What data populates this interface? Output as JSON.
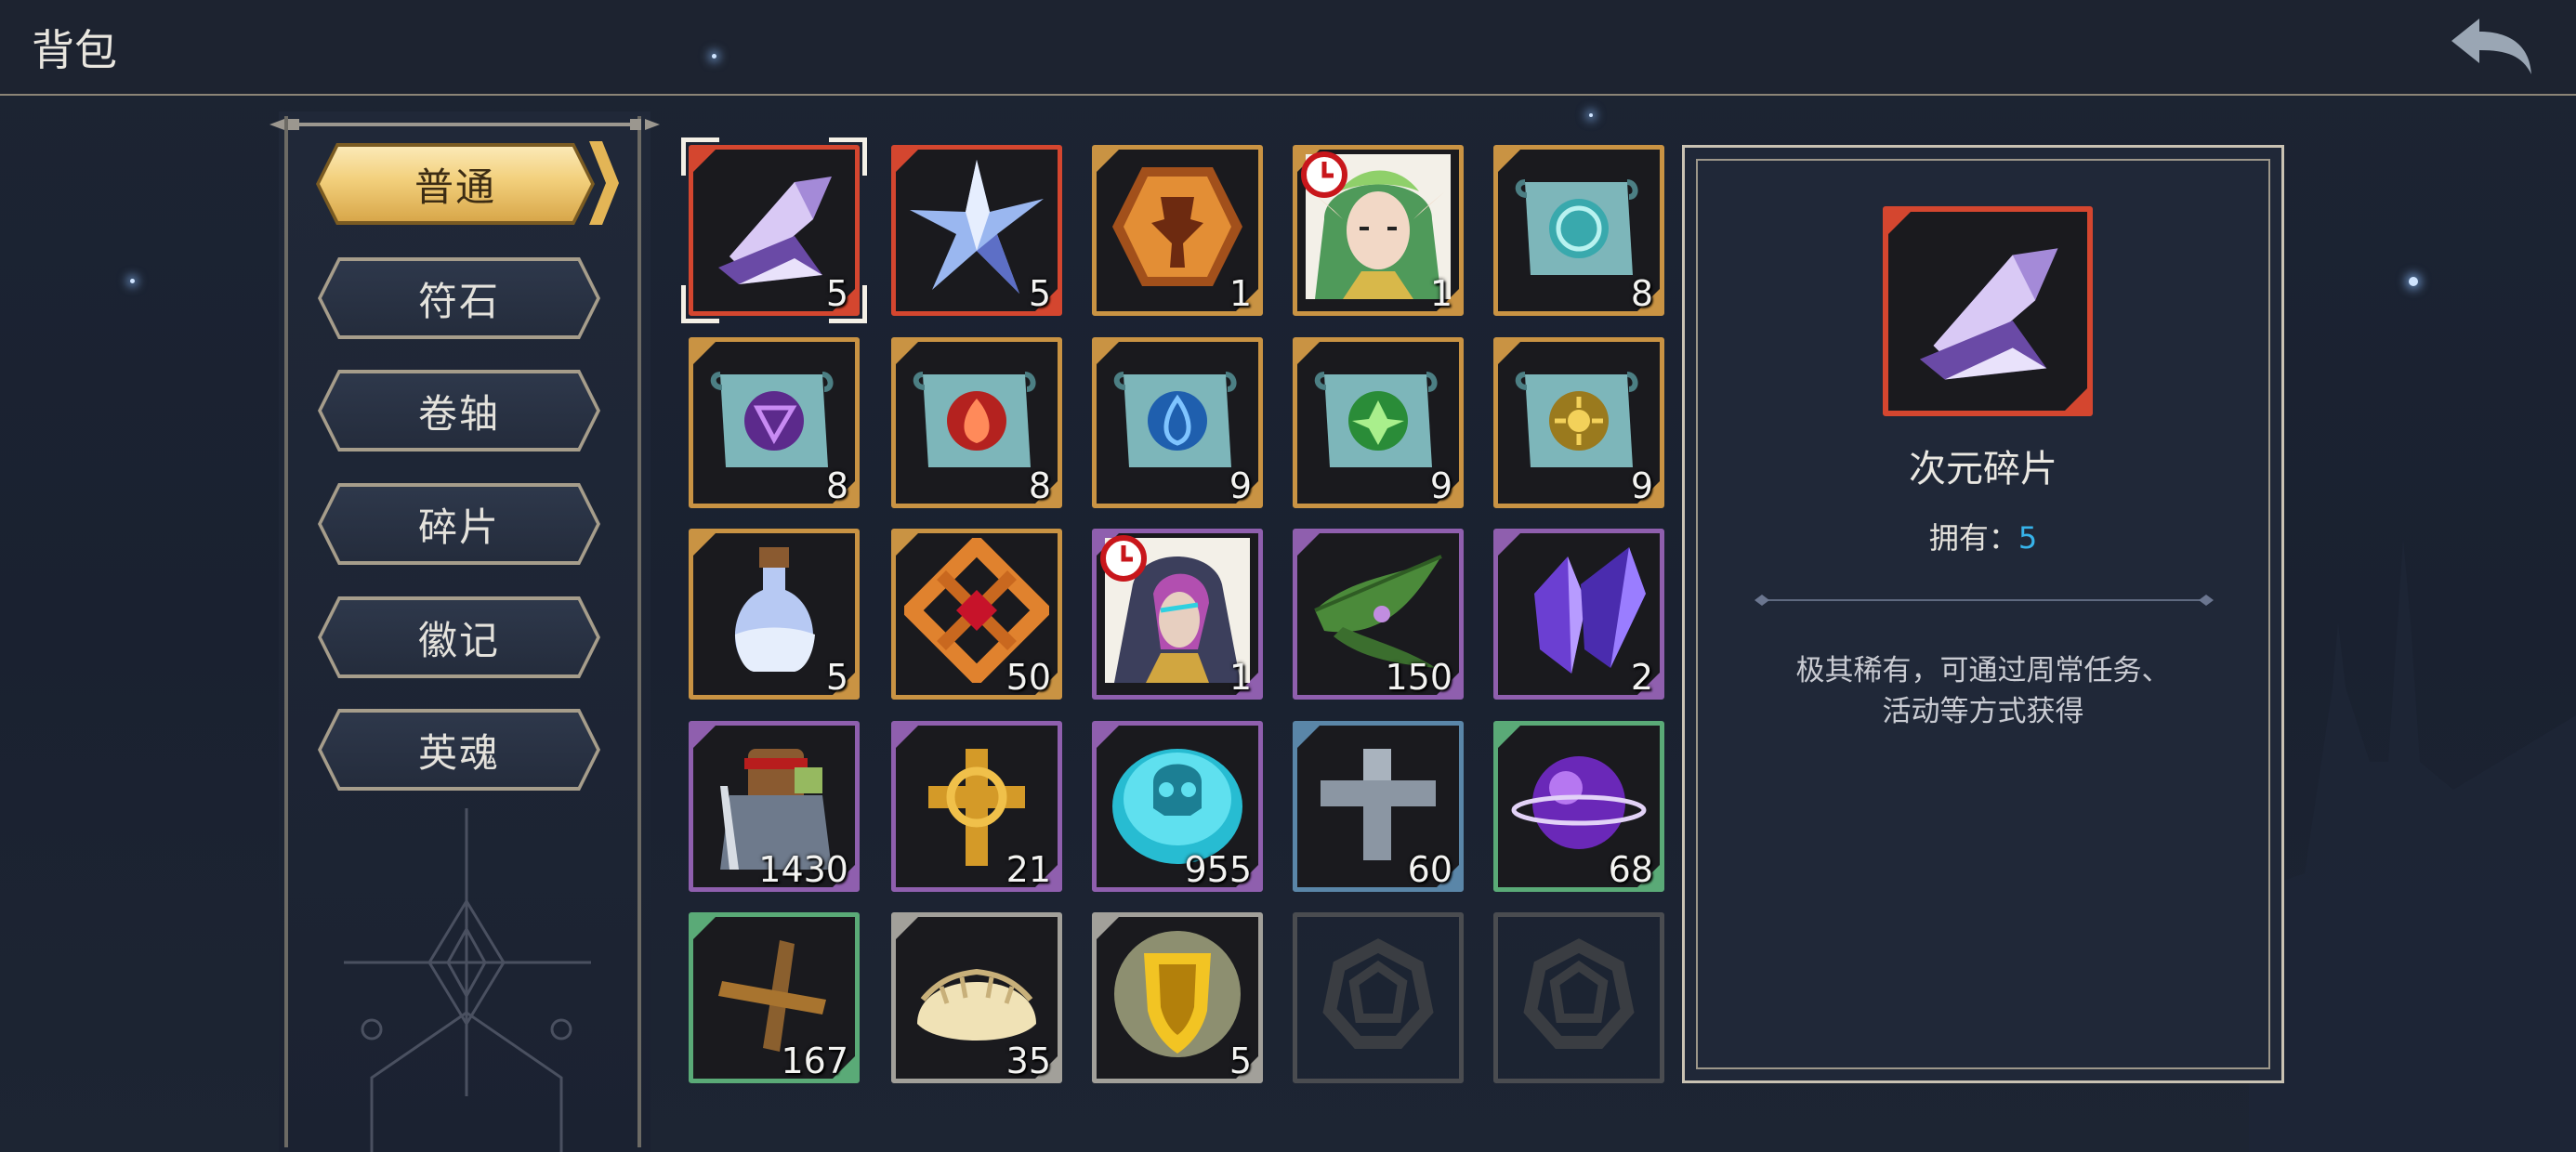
{
  "header": {
    "title": "背包",
    "back_icon": "back-arrow-icon"
  },
  "categories": [
    {
      "label": "普通",
      "active": true
    },
    {
      "label": "符石",
      "active": false
    },
    {
      "label": "卷轴",
      "active": false
    },
    {
      "label": "碎片",
      "active": false
    },
    {
      "label": "徽记",
      "active": false
    },
    {
      "label": "英魂",
      "active": false
    }
  ],
  "items": [
    {
      "icon": "dimension-shard-icon",
      "rarity": "red",
      "count": "5",
      "selected": true
    },
    {
      "icon": "star-crystal-icon",
      "rarity": "red",
      "count": "5"
    },
    {
      "icon": "bronze-emblem-icon",
      "rarity": "gold",
      "count": "1"
    },
    {
      "icon": "elf-hero-portrait-icon",
      "rarity": "gold",
      "count": "1",
      "timed": true
    },
    {
      "icon": "cyan-rune-scroll-icon",
      "rarity": "gold",
      "count": "8"
    },
    {
      "icon": "purple-rune-scroll-icon",
      "rarity": "gold",
      "count": "8"
    },
    {
      "icon": "fire-rune-scroll-icon",
      "rarity": "gold",
      "count": "8"
    },
    {
      "icon": "water-rune-scroll-icon",
      "rarity": "gold",
      "count": "9"
    },
    {
      "icon": "leaf-rune-scroll-icon",
      "rarity": "gold",
      "count": "9"
    },
    {
      "icon": "sun-rune-scroll-icon",
      "rarity": "gold",
      "count": "9"
    },
    {
      "icon": "potion-bottle-icon",
      "rarity": "gold",
      "count": "5"
    },
    {
      "icon": "ruby-amulet-icon",
      "rarity": "gold",
      "count": "50"
    },
    {
      "icon": "mage-hero-portrait-icon",
      "rarity": "purple",
      "count": "1",
      "timed": true
    },
    {
      "icon": "green-leaf-icon",
      "rarity": "purple",
      "count": "150"
    },
    {
      "icon": "purple-crystal-icon",
      "rarity": "purple",
      "count": "2"
    },
    {
      "icon": "warrior-figure-icon",
      "rarity": "purple",
      "count": "1430"
    },
    {
      "icon": "golden-cross-icon",
      "rarity": "purple",
      "count": "21"
    },
    {
      "icon": "skull-coin-icon",
      "rarity": "purple",
      "count": "955"
    },
    {
      "icon": "stone-cross-icon",
      "rarity": "blue",
      "count": "60"
    },
    {
      "icon": "purple-orb-icon",
      "rarity": "green",
      "count": "68"
    },
    {
      "icon": "wooden-cross-icon",
      "rarity": "green",
      "count": "167"
    },
    {
      "icon": "dumpling-icon",
      "rarity": "grey",
      "count": "35"
    },
    {
      "icon": "gold-shield-icon",
      "rarity": "grey",
      "count": "5"
    },
    {
      "icon": "empty-slot-icon",
      "rarity": "empty",
      "count": ""
    },
    {
      "icon": "empty-slot-icon",
      "rarity": "empty",
      "count": ""
    }
  ],
  "rarity_colors": {
    "red": "#d4462f",
    "gold": "#c99343",
    "purple": "#8f5fae",
    "blue": "#5a86a8",
    "green": "#5aaa77",
    "grey": "#a2a09a"
  },
  "detail": {
    "name": "次元碎片",
    "owned_label": "拥有：",
    "owned_value": "5",
    "description": "极其稀有，可通过周常任务、\n活动等方式获得"
  }
}
